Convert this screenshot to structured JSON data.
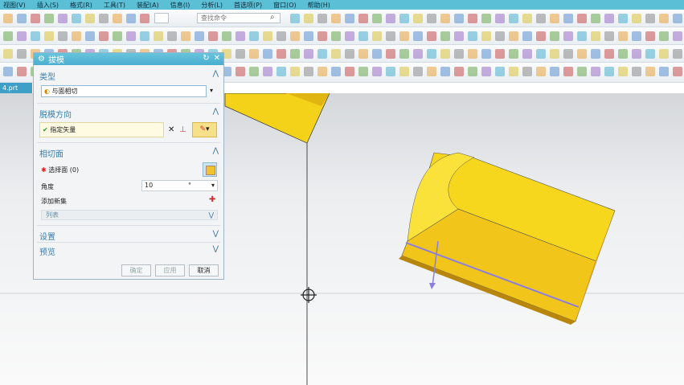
{
  "menu": [
    {
      "label": "视图(V)"
    },
    {
      "label": "插入(S)"
    },
    {
      "label": "格式(R)"
    },
    {
      "label": "工具(T)"
    },
    {
      "label": "装配(A)"
    },
    {
      "label": "信息(I)"
    },
    {
      "label": "分析(L)"
    },
    {
      "label": "首选项(P)"
    },
    {
      "label": "窗口(O)"
    },
    {
      "label": "帮助(H)"
    }
  ],
  "toolbar": {
    "search_placeholder": "查找命令"
  },
  "part_tab": "4.prt",
  "dialog": {
    "title": "拔模",
    "type_section": "类型",
    "type_value": "与面相切",
    "draft_dir_section": "脱模方向",
    "specify_vector": "指定矢量",
    "tangent_section": "相切面",
    "select_face": "选择面 (0)",
    "angle_label": "角度",
    "angle_value": "10",
    "angle_unit": "°",
    "add_set": "添加新集",
    "list_label": "列表",
    "settings_section": "设置",
    "preview_section": "预览",
    "ok": "确定",
    "apply": "应用",
    "cancel": "取消"
  },
  "colors": {
    "accent": "#4aaed0",
    "menubar": "#5bbfd6",
    "solid": "#f5d21a",
    "solid_side": "#c48f0a",
    "axis": "#8a7fe0"
  }
}
